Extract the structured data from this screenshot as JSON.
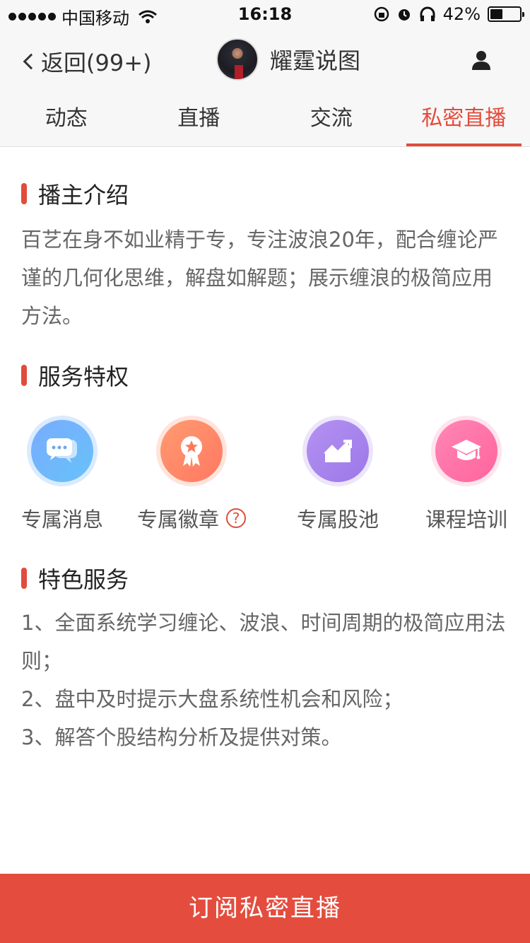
{
  "status_bar": {
    "carrier": "中国移动",
    "time": "16:18",
    "battery": "42%",
    "battery_level": 0.42
  },
  "nav": {
    "back_label": "返回(99+)",
    "title": "耀霆说图"
  },
  "tabs": [
    {
      "label": "动态"
    },
    {
      "label": "直播"
    },
    {
      "label": "交流"
    },
    {
      "label": "私密直播"
    }
  ],
  "active_tab": "私密直播",
  "intro": {
    "title": "播主介绍",
    "text": "百艺在身不如业精于专，专注波浪20年，配合缠论严谨的几何化思维，解盘如解题；展示缠浪的极简应用方法。"
  },
  "privileges": {
    "title": "服务特权",
    "items": [
      {
        "label": "专属消息",
        "icon": "chat-bubbles-icon"
      },
      {
        "label": "专属徽章",
        "icon": "badge-medal-icon",
        "help_icon": "?"
      },
      {
        "label": "专属股池",
        "icon": "stock-chart-icon"
      },
      {
        "label": "课程培训",
        "icon": "graduation-cap-icon"
      }
    ]
  },
  "special": {
    "title": "特色服务",
    "items": [
      "1、全面系统学习缠论、波浪、时间周期的极简应用法则；",
      "2、盘中及时提示大盘系统性机会和风险；",
      "3、解答个股结构分析及提供对策。"
    ]
  },
  "subscribe_label": "订阅私密直播",
  "colors": {
    "accent": "#e14c3d",
    "button": "#e44d3e",
    "header_bg": "#f7f7f7"
  }
}
